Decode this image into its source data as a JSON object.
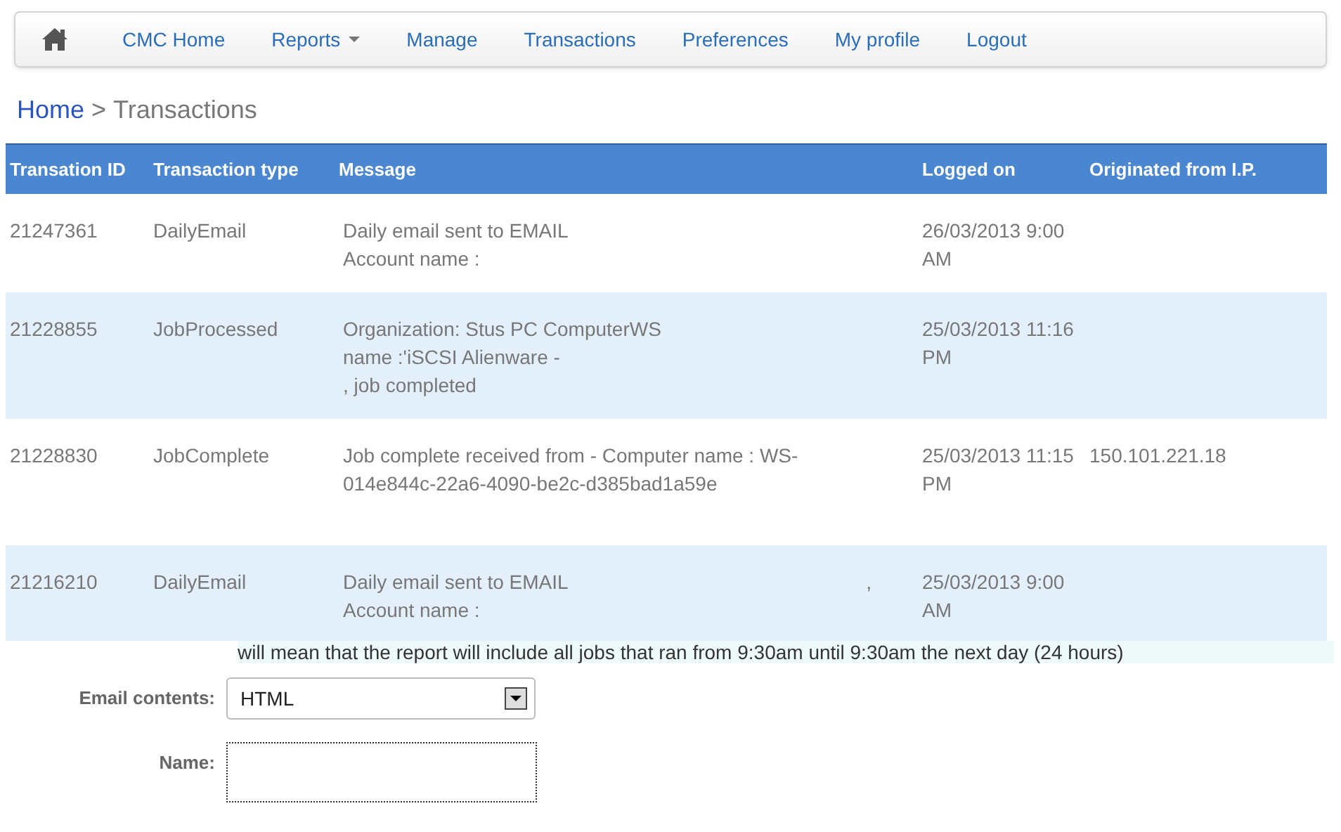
{
  "navbar": {
    "items": [
      {
        "kind": "home"
      },
      {
        "kind": "link",
        "label": "CMC Home"
      },
      {
        "kind": "dropdown",
        "label": "Reports"
      },
      {
        "kind": "link",
        "label": "Manage"
      },
      {
        "kind": "link",
        "label": "Transactions"
      },
      {
        "kind": "link",
        "label": "Preferences"
      },
      {
        "kind": "link",
        "label": "My profile"
      },
      {
        "kind": "link",
        "label": "Logout"
      }
    ]
  },
  "breadcrumb": {
    "link": "Home",
    "separator": ">",
    "current": "Transactions"
  },
  "table": {
    "columns": [
      "Transation ID",
      "Transaction type",
      "Message",
      "Logged on",
      "Originated from I.P."
    ],
    "rows": [
      {
        "id": "21247361",
        "type": "DailyEmail",
        "message": [
          "Daily email sent to EMAIL",
          "Account name :"
        ],
        "logged_on": "26/03/2013 9:00 AM"
      },
      {
        "id": "21228855",
        "type": "JobProcessed",
        "message": [
          "Organization: Stus PC ComputerWS",
          "name :'iSCSI Alienware -",
          ", job completed"
        ],
        "logged_on": "25/03/2013 11:16 PM"
      },
      {
        "id": "21228830",
        "type": "JobComplete",
        "message": [
          "Job complete received from - Computer name : WS-014e844c-22a6-4090-be2c-d385bad1a59e"
        ],
        "logged_on": "25/03/2013 11:15 PM",
        "ip": "150.101.221.18"
      },
      {
        "id": "21216210",
        "type": "DailyEmail",
        "message": [
          "Daily email sent to EMAIL",
          "Account name :"
        ],
        "note": ",",
        "logged_on": "25/03/2013 9:00 AM"
      }
    ]
  },
  "form": {
    "hint": "will mean that the report will include all jobs that ran from 9:30am until 9:30am the next day (24 hours)",
    "fields": [
      {
        "kind": "select",
        "label": "Email contents:",
        "value": "HTML"
      },
      {
        "kind": "text",
        "label": "Name:"
      }
    ]
  }
}
